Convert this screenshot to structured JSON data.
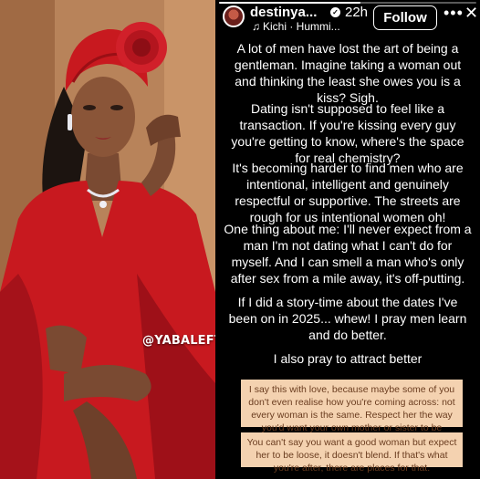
{
  "watermark": "@YABALEFTONLINE",
  "photo": {
    "subject_alt": "woman-in-red"
  },
  "story": {
    "progress": 0.55,
    "username": "destinya...",
    "verified_glyph": "✓",
    "time": "22h",
    "music": {
      "note_icon": "♫",
      "label": "Kichi · Hummi..."
    },
    "follow_label": "Follow",
    "more_icon": "•••",
    "close_icon": "✕",
    "paragraphs": [
      "A lot of men have lost the art of being a gentleman. Imagine taking a woman out and thinking the least she owes you is a kiss? Sigh.",
      "Dating isn't supposed to feel like a transaction. If you're kissing every guy you're getting to know, where's the space for real chemistry?",
      "It's becoming harder to find men who are intentional, intelligent and genuinely respectful or supportive. The streets are rough for us intentional women oh!",
      "One thing about me: I'll never expect from a man I'm not dating what I can't do for myself. And I can smell a man who's only after sex from a mile away, it's off-putting.",
      "If I did a story-time about the dates I've been on in 2025... whew! I pray men learn and do better.",
      "I also pray to attract better"
    ],
    "cards": [
      "I say this with love, because maybe some of you don't even realise how you're coming across: not every woman is the same. Respect her the way you'd want your own mother or sister to be respected.",
      "You can't say you want a good woman but expect her to be loose, it doesn't blend. If that's what you're after, there are places for that."
    ]
  },
  "colors": {
    "dress_red": "#c8191f",
    "background_wall": "#b8835a",
    "card_bg": "#f4d2b0",
    "card_text": "#6a3c1f"
  }
}
